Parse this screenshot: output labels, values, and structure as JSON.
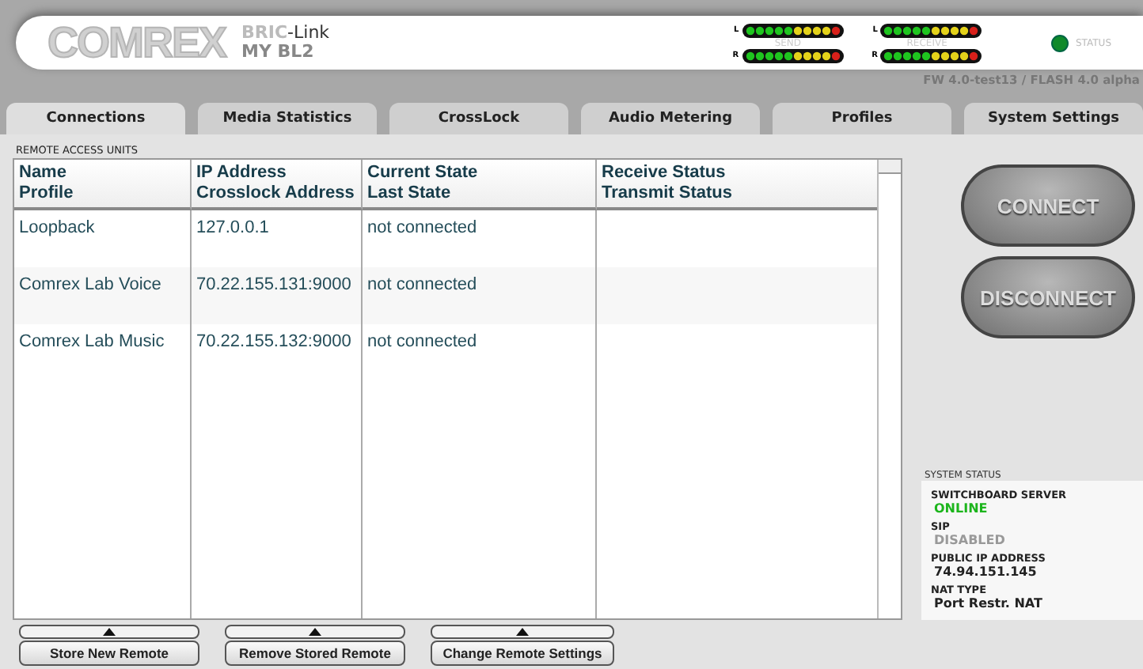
{
  "header": {
    "logo": "COMREX",
    "product_prefix": "BRIC",
    "product_suffix": "-Link",
    "device_name": "MY BL2",
    "meters": [
      {
        "caption": "SEND",
        "channels": [
          "L",
          "R"
        ]
      },
      {
        "caption": "RECEIVE",
        "channels": [
          "L",
          "R"
        ]
      }
    ],
    "status": {
      "label": "STATUS",
      "color": "#0f8a2a"
    },
    "firmware": "FW 4.0-test13 / FLASH 4.0 alpha"
  },
  "tabs": [
    {
      "label": "Connections",
      "selected": true
    },
    {
      "label": "Media Statistics",
      "selected": false
    },
    {
      "label": "CrossLock",
      "selected": false
    },
    {
      "label": "Audio Metering",
      "selected": false
    },
    {
      "label": "Profiles",
      "selected": false
    },
    {
      "label": "System Settings",
      "selected": false
    }
  ],
  "section_title": "REMOTE ACCESS UNITS",
  "table": {
    "columns": [
      "Name\nProfile",
      "IP Address\nCrosslock Address",
      "Current State\nLast State",
      "Receive Status\nTransmit Status"
    ],
    "rows": [
      [
        "Loopback",
        "127.0.0.1",
        "not connected"
      ],
      [
        "Comrex Lab Voice",
        "70.22.155.131:9000",
        "not connected"
      ],
      [
        "Comrex Lab Music",
        "70.22.155.132:9000",
        "not connected"
      ]
    ]
  },
  "actions": [
    "CONNECT",
    "DISCONNECT"
  ],
  "system_status": {
    "title": "SYSTEM STATUS",
    "items": [
      {
        "label": "SWITCHBOARD SERVER",
        "value": "ONLINE",
        "kind": "ok"
      },
      {
        "label": "SIP",
        "value": "DISABLED",
        "kind": "off"
      },
      {
        "label": "PUBLIC IP ADDRESS",
        "value": "74.94.151.145",
        "kind": "plain"
      },
      {
        "label": "NAT TYPE",
        "value": "Port Restr. NAT",
        "kind": "plain"
      }
    ]
  },
  "bottom_buttons": [
    "Store New Remote",
    "Remove Stored Remote",
    "Change Remote Settings"
  ]
}
